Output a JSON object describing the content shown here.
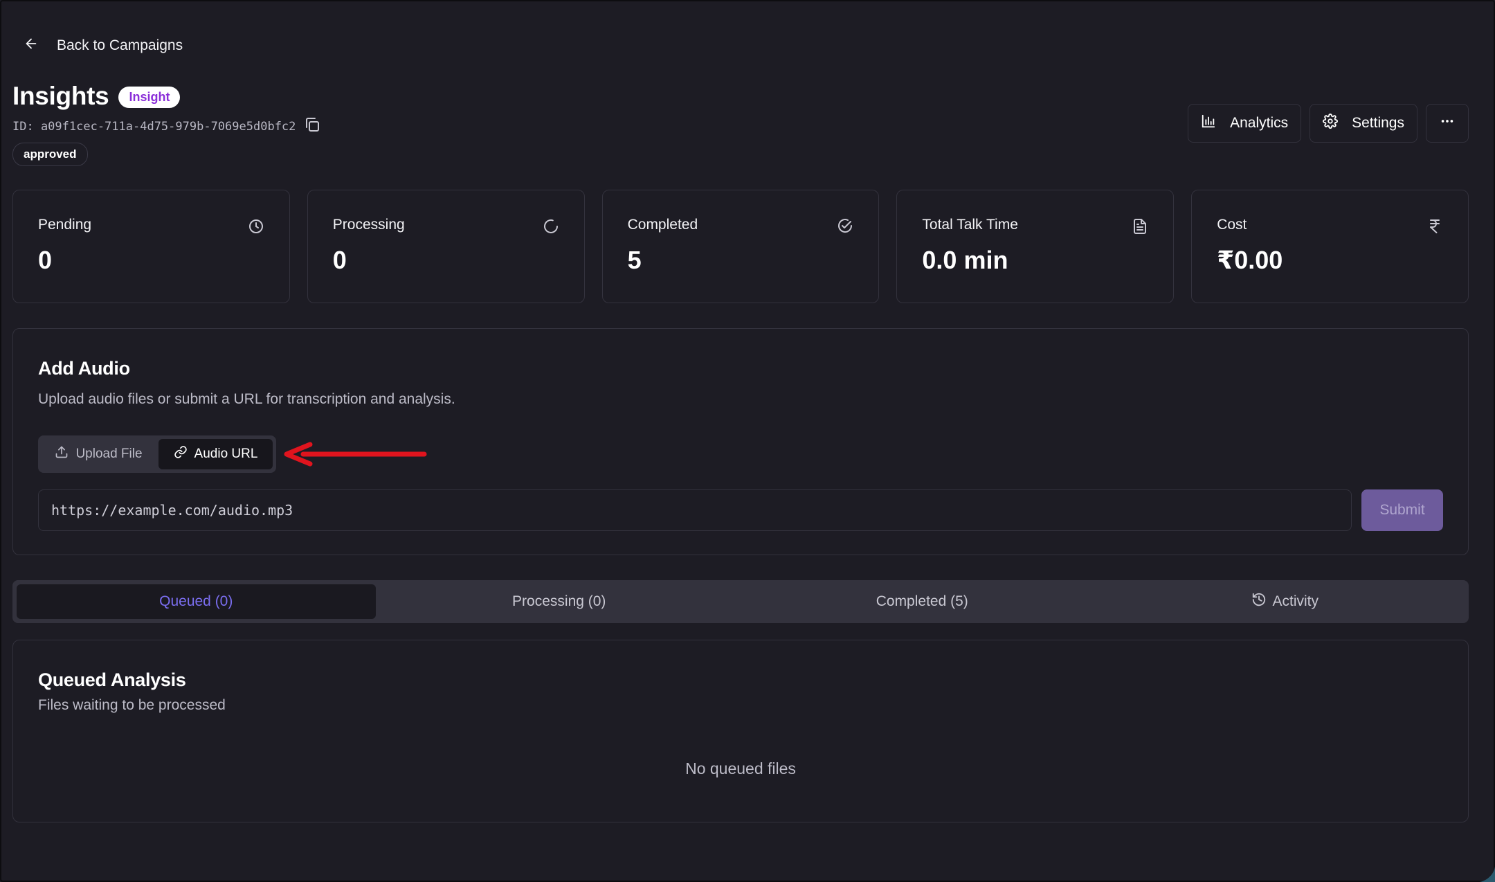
{
  "nav": {
    "back_label": "Back to Campaigns"
  },
  "header": {
    "title": "Insights",
    "badge": "Insight",
    "id_text": "ID: a09f1cec-711a-4d75-979b-7069e5d0bfc2",
    "status": "approved"
  },
  "actions": {
    "analytics_label": "Analytics",
    "settings_label": "Settings"
  },
  "stats": [
    {
      "label": "Pending",
      "value": "0",
      "icon": "clock-icon"
    },
    {
      "label": "Processing",
      "value": "0",
      "icon": "spinner-icon"
    },
    {
      "label": "Completed",
      "value": "5",
      "icon": "check-circle-icon"
    },
    {
      "label": "Total Talk Time",
      "value": "0.0 min",
      "icon": "file-icon"
    },
    {
      "label": "Cost",
      "value": "₹0.00",
      "icon": "rupee-icon"
    }
  ],
  "add_audio": {
    "title": "Add Audio",
    "subtitle": "Upload audio files or submit a URL for transcription and analysis.",
    "modes": [
      {
        "label": "Upload File",
        "active": false
      },
      {
        "label": "Audio URL",
        "active": true
      }
    ],
    "url_placeholder": "https://example.com/audio.mp3",
    "submit_label": "Submit"
  },
  "tabs": [
    {
      "label": "Queued (0)",
      "active": true
    },
    {
      "label": "Processing (0)",
      "active": false
    },
    {
      "label": "Completed (5)",
      "active": false
    },
    {
      "label": "Activity",
      "active": false
    }
  ],
  "queued": {
    "title": "Queued Analysis",
    "subtitle": "Files waiting to be processed",
    "empty_text": "No queued files"
  },
  "colors": {
    "background": "#1d1c24",
    "accent": "#7b6ef0",
    "badge_text": "#8b2fd9",
    "annotation_arrow": "#e0141e"
  }
}
